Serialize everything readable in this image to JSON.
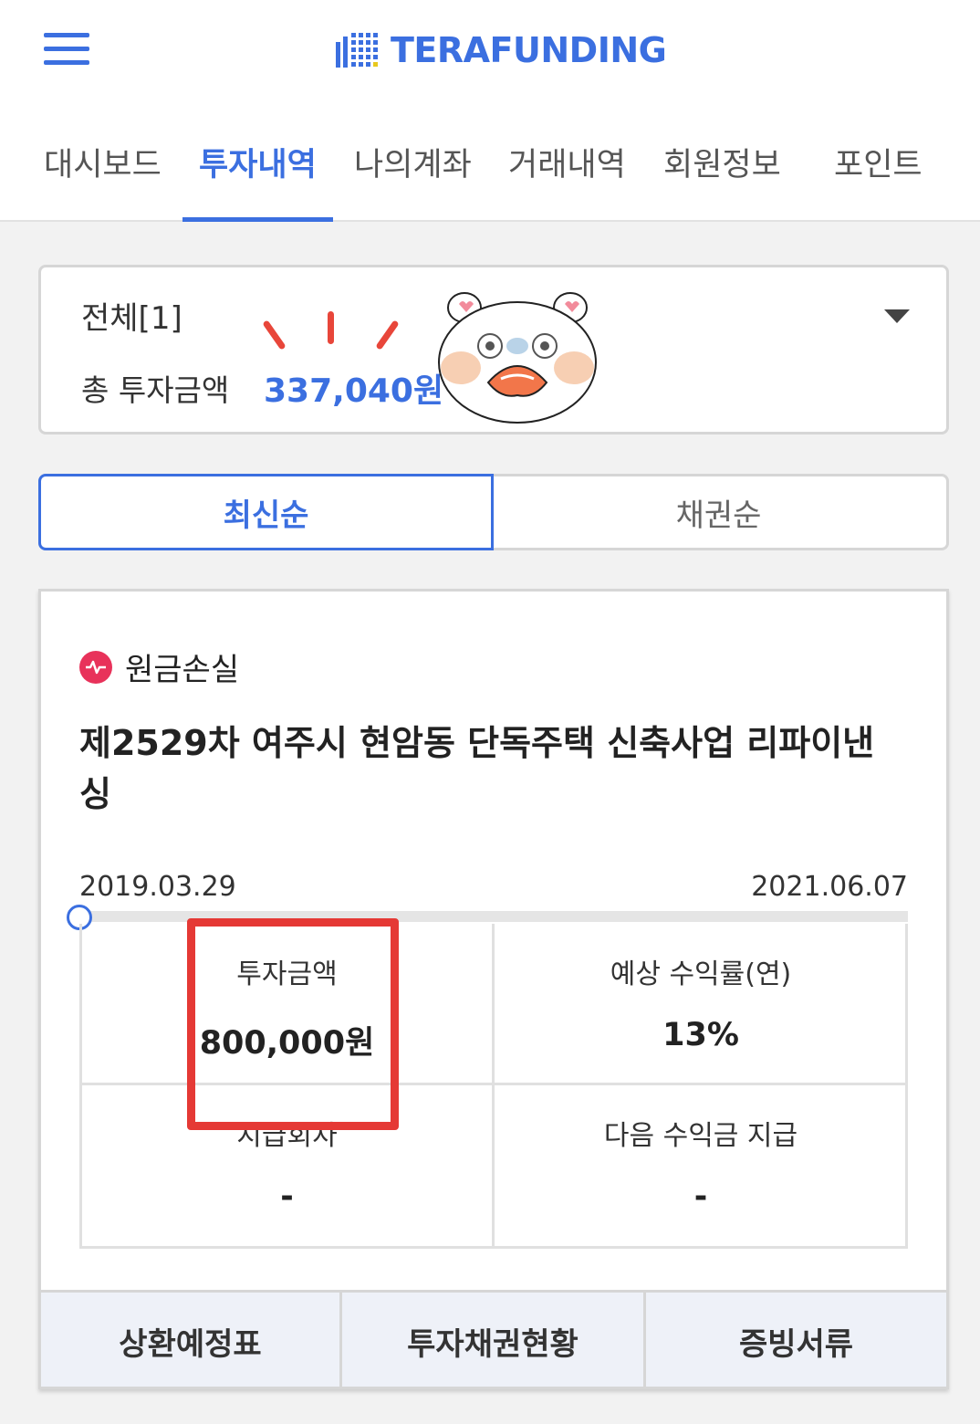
{
  "header": {
    "logo_text": "TERAFUNDING",
    "brand_color": "#3b6fe0"
  },
  "tabs": [
    {
      "label": "대시보드",
      "active": false
    },
    {
      "label": "투자내역",
      "active": true
    },
    {
      "label": "나의계좌",
      "active": false
    },
    {
      "label": "거래내역",
      "active": false
    },
    {
      "label": "회원정보",
      "active": false
    },
    {
      "label": "포인트",
      "active": false
    }
  ],
  "summary": {
    "filter_label": "전체[1]",
    "total_label": "총 투자금액",
    "total_value": "337,040원"
  },
  "sort": {
    "latest": "최신순",
    "bond": "채권순"
  },
  "investment": {
    "status_text": "원금손실",
    "status_color": "#e8325a",
    "title": "제2529차 여주시 현암동 단독주택 신축사업 리파이낸싱",
    "start_date": "2019.03.29",
    "end_date": "2021.06.07",
    "progress": 0,
    "stats": {
      "amount_label": "투자금액",
      "amount_value": "800,000원",
      "rate_label": "예상 수익률(연)",
      "rate_value": "13%",
      "round_label": "지급회차",
      "round_value": "-",
      "next_label": "다음 수익금 지급",
      "next_value": "-"
    },
    "actions": {
      "schedule": "상환예정표",
      "bond_status": "투자채권현황",
      "documents": "증빙서류"
    }
  }
}
